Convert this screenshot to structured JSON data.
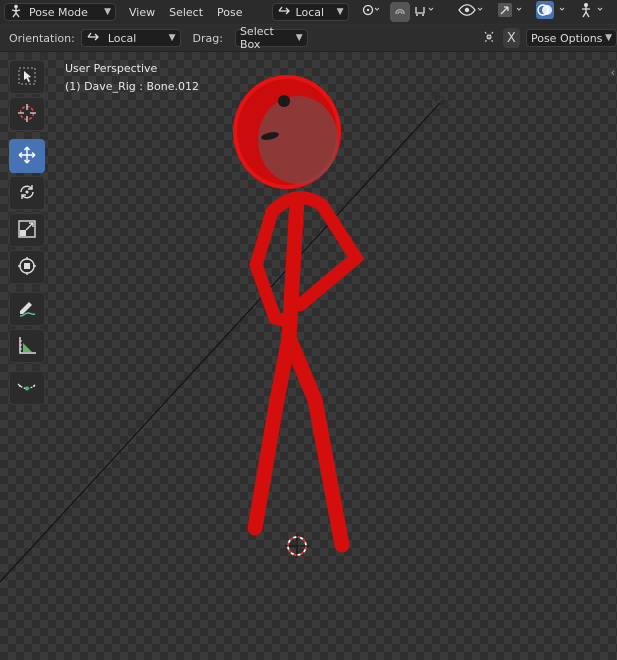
{
  "header": {
    "mode_label": "Pose Mode",
    "menus": [
      "View",
      "Select",
      "Pose"
    ],
    "transform_space": "Local"
  },
  "toolsettings": {
    "orientation_label": "Orientation:",
    "orientation_value": "Local",
    "drag_label": "Drag:",
    "drag_value": "Select Box",
    "x_button": "X",
    "pose_options_label": "Pose Options"
  },
  "viewport": {
    "perspective": "User Perspective",
    "object_info": "(1) Dave_Rig : Bone.012"
  },
  "tools": [
    {
      "name": "select-box-icon",
      "active": false
    },
    {
      "name": "cursor-icon",
      "active": false
    },
    {
      "name": "move-icon",
      "active": true
    },
    {
      "name": "rotate-icon",
      "active": false
    },
    {
      "name": "scale-icon",
      "active": false
    },
    {
      "name": "transform-icon",
      "active": false
    },
    {
      "name": "annotate-icon",
      "active": false
    },
    {
      "name": "measure-icon",
      "active": false
    },
    {
      "name": "relax-pose-icon",
      "active": false
    }
  ],
  "colors": {
    "accent": "#4772b3",
    "mesh_red": "#d40d0d",
    "header_bg": "#2b2b2b"
  }
}
